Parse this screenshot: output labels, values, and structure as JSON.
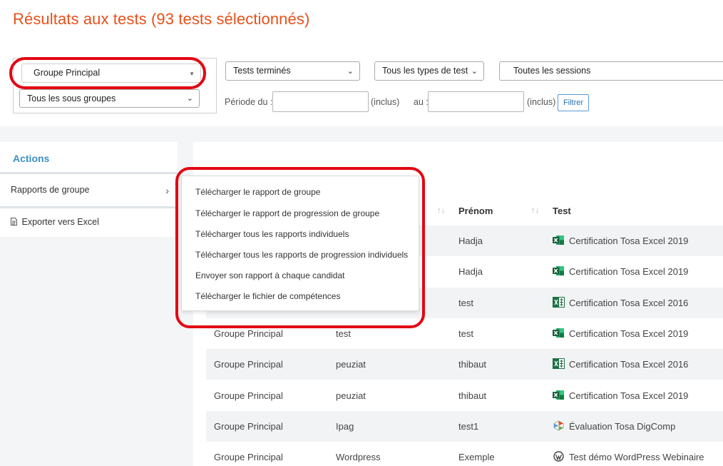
{
  "page_title": "Résultats aux tests (93 tests sélectionnés)",
  "filters": {
    "group": "Groupe Principal",
    "subgroup": "Tous les sous groupes",
    "status": "Tests terminés",
    "test_type": "Tous les types de test",
    "session": "Toutes les sessions",
    "period_from_label": "Période du :",
    "inclus1": "(inclus)",
    "period_to_label": "au :",
    "inclus2": "(inclus)",
    "filter_button": "Filtrer"
  },
  "actions": {
    "title": "Actions",
    "group_reports": "Rapports de groupe",
    "export_excel": "Exporter vers Excel"
  },
  "dropdown_items": [
    "Télécharger le rapport de groupe",
    "Télécharger le rapport de progression de groupe",
    "Télécharger tous les rapports individuels",
    "Télécharger tous les rapports de progression individuels",
    "Envoyer son rapport à chaque candidat",
    "Télécharger le fichier de compétences"
  ],
  "table": {
    "headers": {
      "prenom": "Prénom",
      "test": "Test"
    },
    "rows": [
      {
        "groupe": "",
        "nom": "",
        "prenom": "Hadja",
        "test": "Certification Tosa Excel 2019",
        "icon": "excel-2019-icon"
      },
      {
        "groupe": "",
        "nom": "",
        "prenom": "Hadja",
        "test": "Certification Tosa Excel 2019",
        "icon": "excel-2019-icon"
      },
      {
        "groupe": "",
        "nom": "",
        "prenom": "test",
        "test": "Certification Tosa Excel 2016",
        "icon": "excel-2016-icon"
      },
      {
        "groupe": "Groupe Principal",
        "nom": "test",
        "prenom": "test",
        "test": "Certification Tosa Excel 2019",
        "icon": "excel-2019-icon"
      },
      {
        "groupe": "Groupe Principal",
        "nom": "peuziat",
        "prenom": "thibaut",
        "test": "Certification Tosa Excel 2016",
        "icon": "excel-2016-icon"
      },
      {
        "groupe": "Groupe Principal",
        "nom": "peuziat",
        "prenom": "thibaut",
        "test": "Certification Tosa Excel 2019",
        "icon": "excel-2019-icon"
      },
      {
        "groupe": "Groupe Principal",
        "nom": "Ipag",
        "prenom": "test1",
        "test": "Évaluation Tosa DigComp",
        "icon": "digcomp-icon"
      },
      {
        "groupe": "Groupe Principal",
        "nom": "Wordpress",
        "prenom": "Exemple",
        "test": "Test démo WordPress Webinaire",
        "icon": "wordpress-icon"
      }
    ]
  },
  "colors": {
    "accent": "#e8501a",
    "link": "#3a8fc4",
    "highlight": "#e30613",
    "excel": "#1d7044"
  }
}
